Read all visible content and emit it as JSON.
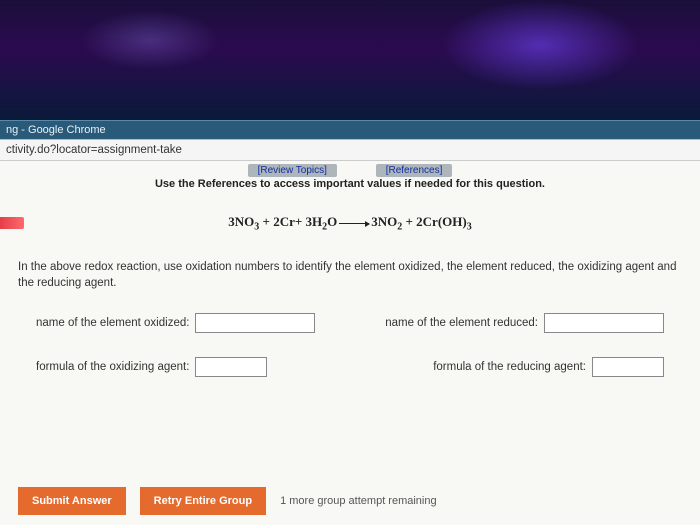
{
  "window": {
    "title": "ng - Google Chrome",
    "url": "ctivity.do?locator=assignment-take"
  },
  "toplinks": {
    "review": "[Review Topics]",
    "references": "[References]"
  },
  "instructions": "Use the References to access important values if needed for this question.",
  "equation": {
    "lhs_coef1": "3NO",
    "lhs_sub1": "3",
    "lhs_plus1": " + 2Cr+ 3H",
    "lhs_sub2": "2",
    "lhs_o": "O",
    "rhs_coef1": "3NO",
    "rhs_sub1": "2",
    "rhs_plus": " + 2Cr(OH)",
    "rhs_sub2": "3"
  },
  "prompt": "In the above redox reaction, use oxidation numbers to identify the element oxidized, the element reduced, the oxidizing agent and the reducing agent.",
  "fields": {
    "oxidized_label": "name of the element oxidized:",
    "reduced_label": "name of the element reduced:",
    "oxidizing_agent_label": "formula of the oxidizing agent:",
    "reducing_agent_label": "formula of the reducing agent:",
    "oxidized_value": "",
    "reduced_value": "",
    "oxidizing_agent_value": "",
    "reducing_agent_value": ""
  },
  "footer": {
    "submit": "Submit Answer",
    "retry": "Retry Entire Group",
    "attempts": "1 more group attempt remaining"
  }
}
